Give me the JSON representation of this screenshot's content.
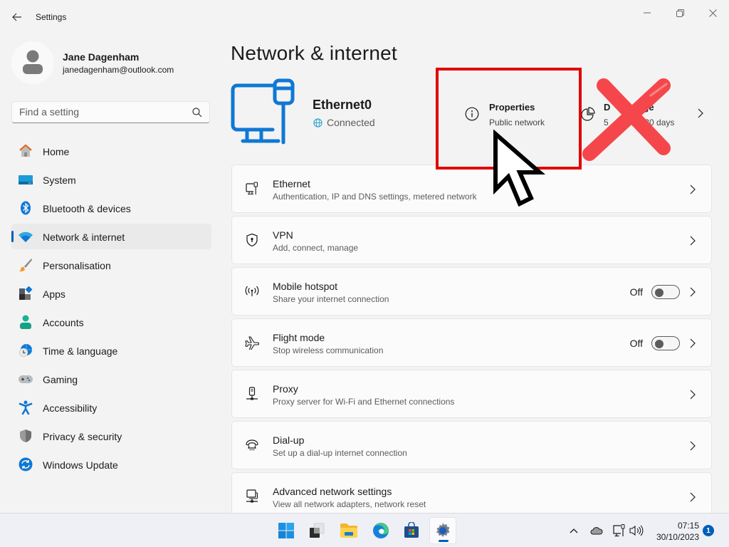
{
  "window": {
    "title": "Settings",
    "controls": [
      "minimize",
      "maximize",
      "close"
    ]
  },
  "profile": {
    "name": "Jane Dagenham",
    "email": "janedagenham@outlook.com"
  },
  "search": {
    "placeholder": "Find a setting",
    "value": ""
  },
  "sidebar": {
    "items": [
      {
        "label": "Home",
        "icon": "home-icon"
      },
      {
        "label": "System",
        "icon": "system-icon"
      },
      {
        "label": "Bluetooth & devices",
        "icon": "bluetooth-icon"
      },
      {
        "label": "Network & internet",
        "icon": "wifi-icon",
        "active": true
      },
      {
        "label": "Personalisation",
        "icon": "brush-icon"
      },
      {
        "label": "Apps",
        "icon": "apps-icon"
      },
      {
        "label": "Accounts",
        "icon": "accounts-icon"
      },
      {
        "label": "Time & language",
        "icon": "time-language-icon"
      },
      {
        "label": "Gaming",
        "icon": "gamepad-icon"
      },
      {
        "label": "Accessibility",
        "icon": "accessibility-icon"
      },
      {
        "label": "Privacy & security",
        "icon": "shield-icon"
      },
      {
        "label": "Windows Update",
        "icon": "update-icon"
      }
    ]
  },
  "main": {
    "title": "Network & internet",
    "connection": {
      "name": "Ethernet0",
      "status": "Connected"
    },
    "properties": {
      "title": "Properties",
      "subtitle": "Public network"
    },
    "data_usage": {
      "title_visible": "D",
      "title_visible_end": "ge",
      "subtitle_visible": "5",
      "subtitle_visible_end": "st 30 days"
    },
    "cards": [
      {
        "title": "Ethernet",
        "subtitle": "Authentication, IP and DNS settings, metered network",
        "icon": "ethernet-icon"
      },
      {
        "title": "VPN",
        "subtitle": "Add, connect, manage",
        "icon": "vpn-shield-icon"
      },
      {
        "title": "Mobile hotspot",
        "subtitle": "Share your internet connection",
        "icon": "hotspot-icon",
        "toggle": {
          "label": "Off",
          "on": false
        }
      },
      {
        "title": "Flight mode",
        "subtitle": "Stop wireless communication",
        "icon": "airplane-icon",
        "toggle": {
          "label": "Off",
          "on": false
        }
      },
      {
        "title": "Proxy",
        "subtitle": "Proxy server for Wi-Fi and Ethernet connections",
        "icon": "proxy-icon"
      },
      {
        "title": "Dial-up",
        "subtitle": "Set up a dial-up internet connection",
        "icon": "dialup-icon"
      },
      {
        "title": "Advanced network settings",
        "subtitle": "View all network adapters, network reset",
        "icon": "advanced-network-icon"
      }
    ]
  },
  "annotations": {
    "highlight_color": "#e10000",
    "cross_color": "#f5474b"
  },
  "taskbar": {
    "apps": [
      "start",
      "task-view",
      "file-explorer",
      "edge",
      "store",
      "settings"
    ],
    "active_app": "settings",
    "time": "07:15",
    "date": "30/10/2023",
    "notification_count": "1"
  },
  "colors": {
    "accent": "#005fb8",
    "icon_blue": "#0f78d4"
  }
}
